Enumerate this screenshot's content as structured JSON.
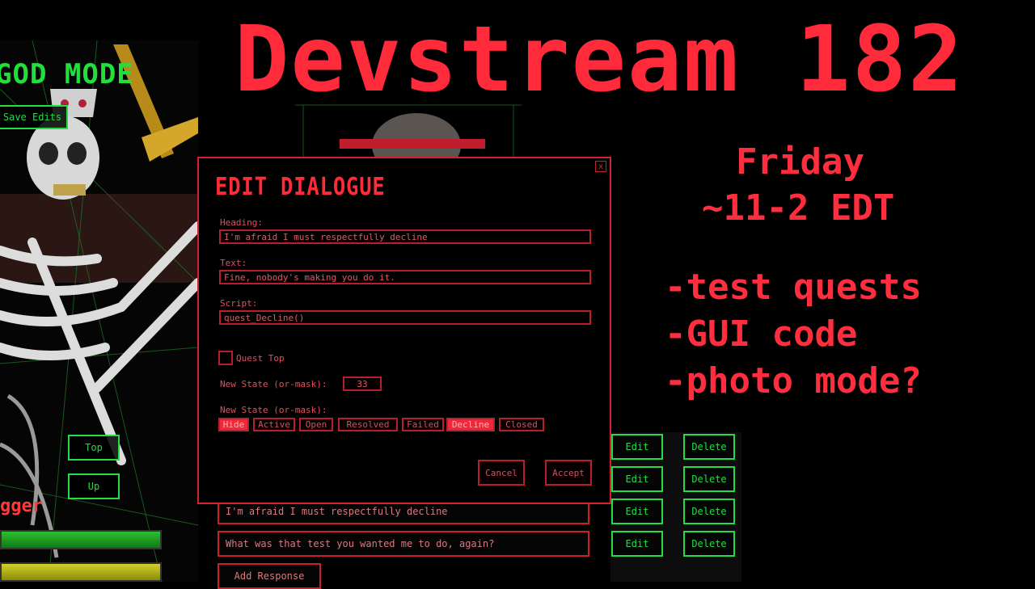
{
  "stream": {
    "title": "Devstream 182",
    "day": "Friday",
    "time": "~11-2 EDT",
    "todo": [
      "-test quests",
      "-GUI code",
      "-photo mode?"
    ]
  },
  "game_ui": {
    "god_mode": "GOD MODE",
    "save_edits": "Save Edits",
    "top": "Top",
    "up": "Up",
    "dagger": "gger",
    "responses": [
      {
        "text": "I'm afraid I must respectfully decline"
      },
      {
        "text": "What was that test you wanted me to do, again?"
      }
    ],
    "edit_label": "Edit",
    "delete_label": "Delete",
    "add_response": "Add Response"
  },
  "dialog": {
    "title": "EDIT DIALOGUE",
    "close": "x",
    "heading_label": "Heading:",
    "heading_value": "I'm afraid I must respectfully decline",
    "text_label": "Text:",
    "text_value": "Fine, nobody's making you do it.",
    "script_label": "Script:",
    "script_value": "quest_Decline()",
    "quest_top_label": "Quest Top",
    "new_state_label": "New State (or-mask):",
    "new_state_value": "33",
    "new_state_label2": "New State (or-mask):",
    "flags": [
      {
        "label": "Hide",
        "on": true
      },
      {
        "label": "Active",
        "on": false
      },
      {
        "label": "Open",
        "on": false
      },
      {
        "label": "Resolved",
        "on": false
      },
      {
        "label": "Failed",
        "on": false
      },
      {
        "label": "Decline",
        "on": true
      },
      {
        "label": "Closed",
        "on": false
      }
    ],
    "cancel": "Cancel",
    "accept": "Accept"
  }
}
